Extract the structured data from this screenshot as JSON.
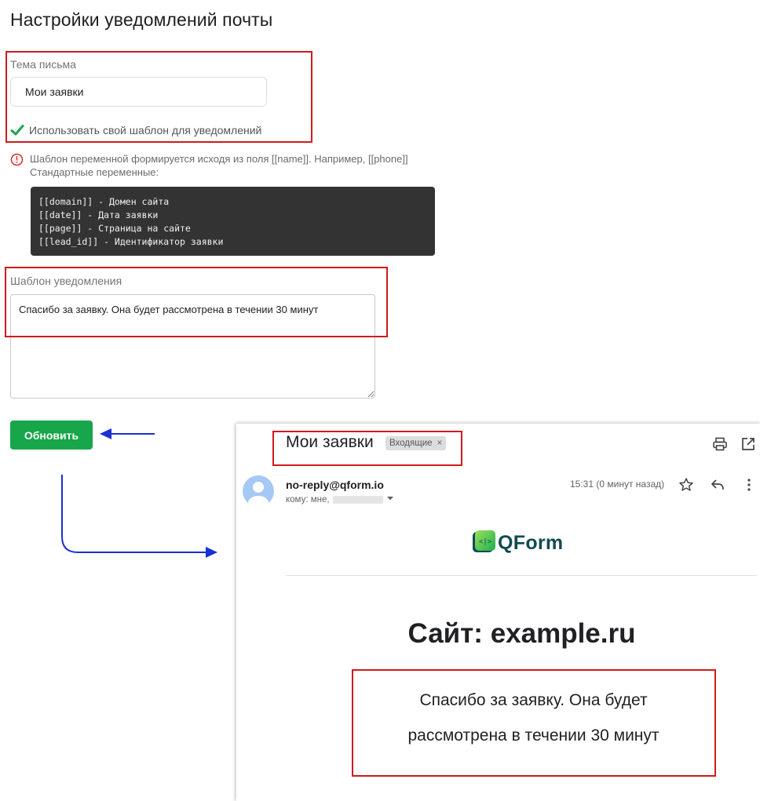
{
  "settings": {
    "title": "Настройки уведомлений почты",
    "subject_label": "Тема письма",
    "subject_value": "Мои заявки",
    "custom_template_label": "Использовать свой шаблон для уведомлений",
    "custom_template_checked": true,
    "info_line1": "Шаблон переменной формируется исходя из поля [[name]]. Например, [[phone]]",
    "info_line2": "Стандартные переменные:",
    "variables": [
      "[[domain]] - Домен сайта",
      "[[date]] - Дата заявки",
      "[[page]] - Страница на сайте",
      "[[lead_id]] - Идентификатор заявки"
    ],
    "template_label": "Шаблон уведомления",
    "template_value": "Спасибо за заявку. Она будет рассмотрена в течении 30 минут",
    "update_button": "Обновить"
  },
  "email": {
    "subject": "Мои заявки",
    "folder_tag": "Входящие",
    "tag_close": "×",
    "sender": "no-reply@qform.io",
    "recipient_prefix": "кому: мне,",
    "time": "15:31 (0 минут назад)",
    "logo_text": "QForm",
    "site_title": "Сайт: example.ru",
    "body_line1": "Спасибо за заявку. Она будет",
    "body_line2": "рассмотрена в течении 30 минут"
  },
  "colors": {
    "accent_green": "#17a64a",
    "highlight_red": "#d11a1a",
    "arrow_blue": "#1a2fd6",
    "code_bg": "#333333"
  }
}
